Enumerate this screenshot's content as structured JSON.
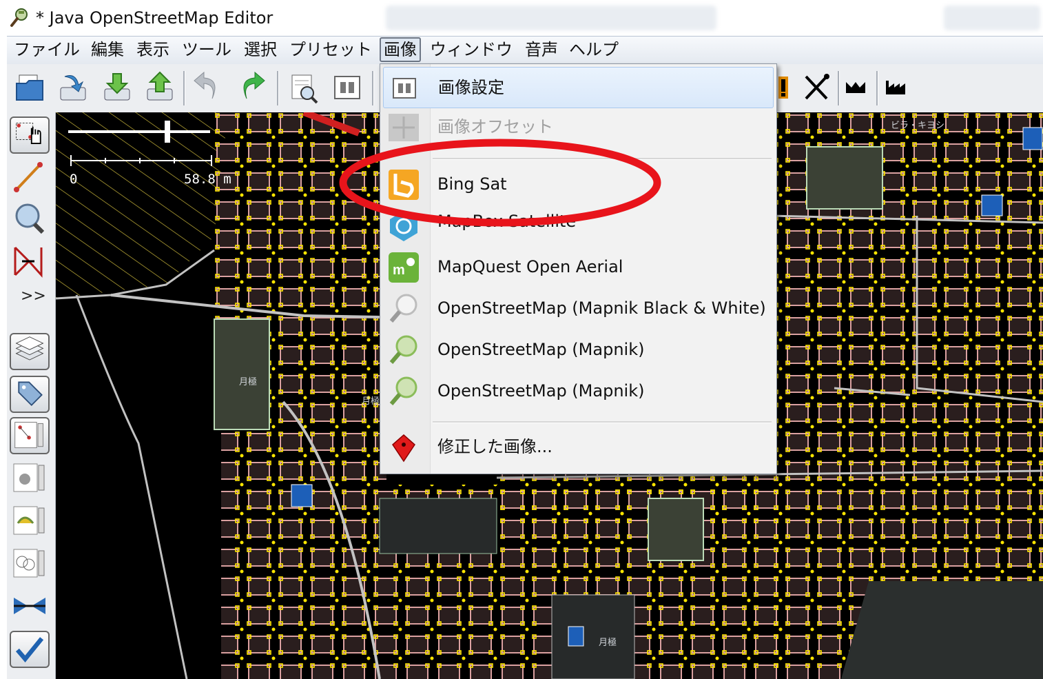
{
  "window": {
    "title": "* Java OpenStreetMap Editor"
  },
  "menubar": {
    "items": [
      "ファイル",
      "編集",
      "表示",
      "ツール",
      "選択",
      "プリセット",
      "画像",
      "ウィンドウ",
      "音声",
      "ヘルプ"
    ],
    "active": "画像"
  },
  "map": {
    "scale_start": "0",
    "scale_end": "58.8 m",
    "labels": [
      "月極",
      "月極",
      "月極",
      "ビラ・キヨシ"
    ]
  },
  "image_menu": {
    "items": [
      {
        "label": "画像設定",
        "icon": "imagery-preferences-icon",
        "state": "hover"
      },
      {
        "label": "画像オフセット",
        "icon": "imagery-offset-icon",
        "state": "disabled"
      },
      {
        "label": "Bing Sat",
        "icon": "bing-icon",
        "state": "normal"
      },
      {
        "label": "MapBox Satellite",
        "icon": "mapbox-icon",
        "state": "normal"
      },
      {
        "label": "MapQuest Open Aerial",
        "icon": "mapquest-icon",
        "state": "normal"
      },
      {
        "label": "OpenStreetMap (Mapnik Black & White)",
        "icon": "magnifier-bw-icon",
        "state": "normal"
      },
      {
        "label": "OpenStreetMap (Mapnik)",
        "icon": "magnifier-green-icon",
        "state": "normal"
      },
      {
        "label": "OpenStreetMap (Mapnik)",
        "icon": "magnifier-green-icon",
        "state": "normal"
      },
      {
        "label": "修正した画像...",
        "icon": "red-pin-icon",
        "state": "normal"
      }
    ]
  },
  "colors": {
    "map_background": "#000000",
    "node_yellow": "#ffee00",
    "building_outline": "#e0a8a8",
    "road_gray": "#bcbcbc",
    "annotation_red": "#e8141b",
    "menu_hover": "#d9e8fa"
  }
}
